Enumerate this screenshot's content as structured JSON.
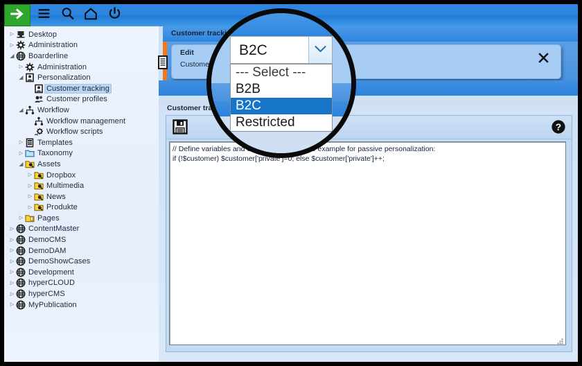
{
  "toolbar": {
    "buttons": [
      {
        "name": "forward-button",
        "icon": "arrow-right-icon",
        "label": "Forward"
      },
      {
        "name": "menu-button",
        "icon": "hamburger-menu-icon",
        "label": "Menu"
      },
      {
        "name": "search-button",
        "icon": "search-icon",
        "label": "Search"
      },
      {
        "name": "home-button",
        "icon": "home-icon",
        "label": "Home"
      },
      {
        "name": "power-button",
        "icon": "power-icon",
        "label": "Logout"
      }
    ]
  },
  "sidebar": {
    "items": [
      {
        "label": "Desktop",
        "depth": 0,
        "arrow": "closed",
        "icon": "desktop-icon",
        "selected": false
      },
      {
        "label": "Administration",
        "depth": 0,
        "arrow": "closed",
        "icon": "gear-icon",
        "selected": false
      },
      {
        "label": "Boarderline",
        "depth": 0,
        "arrow": "open",
        "icon": "globe-icon",
        "selected": false
      },
      {
        "label": "Administration",
        "depth": 1,
        "arrow": "closed",
        "icon": "gear-icon",
        "selected": false
      },
      {
        "label": "Personalization",
        "depth": 1,
        "arrow": "open",
        "icon": "person-card-icon",
        "selected": false
      },
      {
        "label": "Customer tracking",
        "depth": 2,
        "arrow": "none",
        "icon": "person-card-icon",
        "selected": true
      },
      {
        "label": "Customer profiles",
        "depth": 2,
        "arrow": "none",
        "icon": "people-icon",
        "selected": false
      },
      {
        "label": "Workflow",
        "depth": 1,
        "arrow": "open",
        "icon": "workflow-icon",
        "selected": false
      },
      {
        "label": "Workflow management",
        "depth": 2,
        "arrow": "none",
        "icon": "workflow-icon",
        "selected": false
      },
      {
        "label": "Workflow scripts",
        "depth": 2,
        "arrow": "none",
        "icon": "script-gear-icon",
        "selected": false
      },
      {
        "label": "Templates",
        "depth": 1,
        "arrow": "closed",
        "icon": "template-icon",
        "selected": false
      },
      {
        "label": "Taxonomy",
        "depth": 1,
        "arrow": "closed",
        "icon": "folder-blue-icon",
        "selected": false
      },
      {
        "label": "Assets",
        "depth": 1,
        "arrow": "open",
        "icon": "folder-asset-icon",
        "selected": false
      },
      {
        "label": "Dropbox",
        "depth": 2,
        "arrow": "closed",
        "icon": "folder-asset-icon",
        "selected": false
      },
      {
        "label": "Multimedia",
        "depth": 2,
        "arrow": "closed",
        "icon": "folder-asset-icon",
        "selected": false
      },
      {
        "label": "News",
        "depth": 2,
        "arrow": "closed",
        "icon": "folder-asset-icon",
        "selected": false
      },
      {
        "label": "Produkte",
        "depth": 2,
        "arrow": "closed",
        "icon": "folder-asset-icon",
        "selected": false
      },
      {
        "label": "Pages",
        "depth": 1,
        "arrow": "closed",
        "icon": "folder-pages-icon",
        "selected": false
      },
      {
        "label": "ContentMaster",
        "depth": 0,
        "arrow": "closed",
        "icon": "globe-icon",
        "selected": false
      },
      {
        "label": "DemoCMS",
        "depth": 0,
        "arrow": "closed",
        "icon": "globe-icon",
        "selected": false
      },
      {
        "label": "DemoDAM",
        "depth": 0,
        "arrow": "closed",
        "icon": "globe-icon",
        "selected": false
      },
      {
        "label": "DemoShowCases",
        "depth": 0,
        "arrow": "closed",
        "icon": "globe-icon",
        "selected": false
      },
      {
        "label": "Development",
        "depth": 0,
        "arrow": "closed",
        "icon": "globe-icon",
        "selected": false
      },
      {
        "label": "hyperCLOUD",
        "depth": 0,
        "arrow": "closed",
        "icon": "globe-icon",
        "selected": false
      },
      {
        "label": "hyperCMS",
        "depth": 0,
        "arrow": "closed",
        "icon": "globe-icon",
        "selected": false
      },
      {
        "label": "MyPublication",
        "depth": 0,
        "arrow": "closed",
        "icon": "globe-icon",
        "selected": false
      }
    ]
  },
  "main": {
    "panel_title": "Customer tracking",
    "edit_label": "Edit",
    "customer_label": "Customer",
    "close_label": "Close",
    "section_label": "Customer tracking",
    "editor": {
      "save_label": "Save",
      "help_label": "Help",
      "code_lines": [
        "// Define variables and customer values, see example for passive personalization:",
        "if (!$customer) $customer['private']=0; else $customer['private']++;"
      ]
    }
  },
  "magnifier": {
    "select": {
      "value": "B2C",
      "options": [
        "--- Select ---",
        "B2B",
        "B2C",
        "Restricted"
      ],
      "highlighted": "B2C"
    }
  },
  "colors": {
    "toolbar_blue": "#2f86df",
    "green_button": "#2fa72f",
    "orange_accent": "#f07a17",
    "selection_blue": "#1675c8",
    "tree_selection": "#bcd6f0"
  }
}
